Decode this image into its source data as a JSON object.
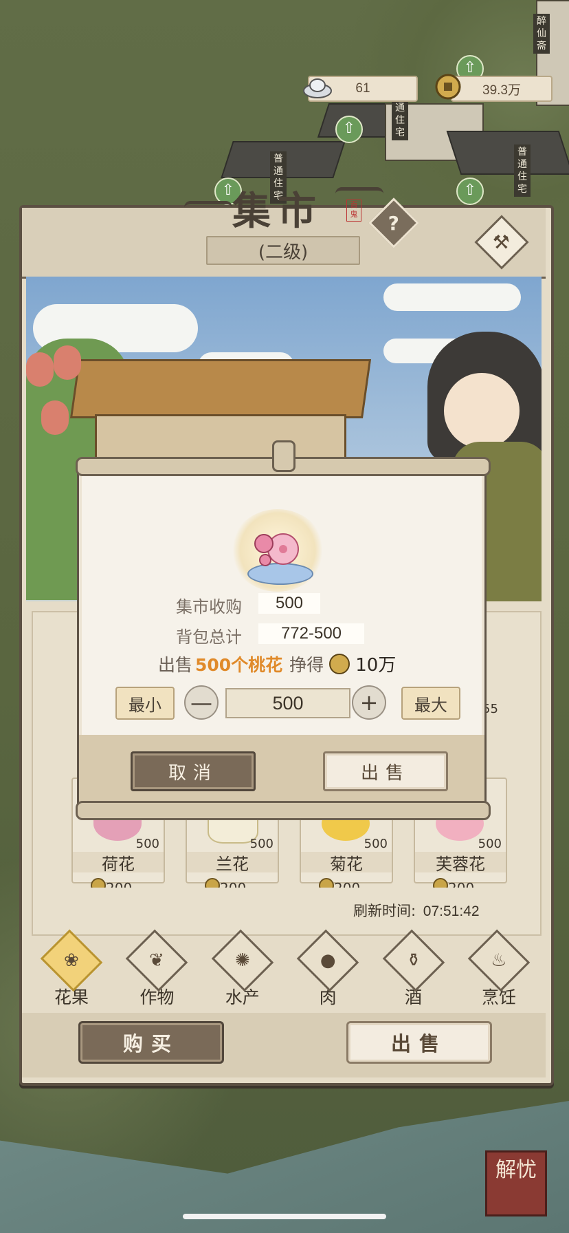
{
  "resources": {
    "silver": "61",
    "copper": "39.3万"
  },
  "map_labels": {
    "building_a": "普通住宅",
    "building_b": "普通住宅",
    "building_c": "普通住宅",
    "building_d": "普通住宅",
    "shop": "醉仙斋"
  },
  "panel": {
    "title": "集市",
    "seal": "百鬼",
    "level": "(二级)",
    "help_icon": "?",
    "category_side": "花果"
  },
  "items": [
    {
      "name": "荷花",
      "qty": "500",
      "price": "200"
    },
    {
      "name": "兰花",
      "qty": "500",
      "price": "200"
    },
    {
      "name": "菊花",
      "qty": "500",
      "price": "200"
    },
    {
      "name": "芙蓉花",
      "qty": "500",
      "price": "200"
    }
  ],
  "hidden_qty": "55",
  "refresh": {
    "label": "刷新时间:",
    "time": "07:51:42"
  },
  "tabs": [
    {
      "label": "花果",
      "icon": "fruit-icon",
      "active": true
    },
    {
      "label": "作物",
      "icon": "crop-icon",
      "active": false
    },
    {
      "label": "水产",
      "icon": "seafood-icon",
      "active": false
    },
    {
      "label": "肉",
      "icon": "meat-icon",
      "active": false
    },
    {
      "label": "酒",
      "icon": "wine-icon",
      "active": false
    },
    {
      "label": "烹饪",
      "icon": "cooking-icon",
      "active": false
    }
  ],
  "bottom_buttons": {
    "buy": "购买",
    "sell": "出售"
  },
  "dialog": {
    "market_buy_label": "集市收购",
    "market_buy_value": "500",
    "bag_total_label": "背包总计",
    "bag_total_value": "772-500",
    "sell_prefix": "出售",
    "sell_count": "500个",
    "sell_item": "桃花",
    "earn_label": "挣得",
    "earn_value": "10万",
    "min_label": "最小",
    "max_label": "最大",
    "minus": "—",
    "plus": "+",
    "quantity": "500",
    "cancel": "取消",
    "confirm": "出售"
  },
  "corner_badge": "解忧",
  "colors": {
    "panel": "#e5dcc8",
    "accent_orange": "#e08a2a",
    "dark_button": "#7a6a58",
    "active_tab": "#f2d27a"
  }
}
